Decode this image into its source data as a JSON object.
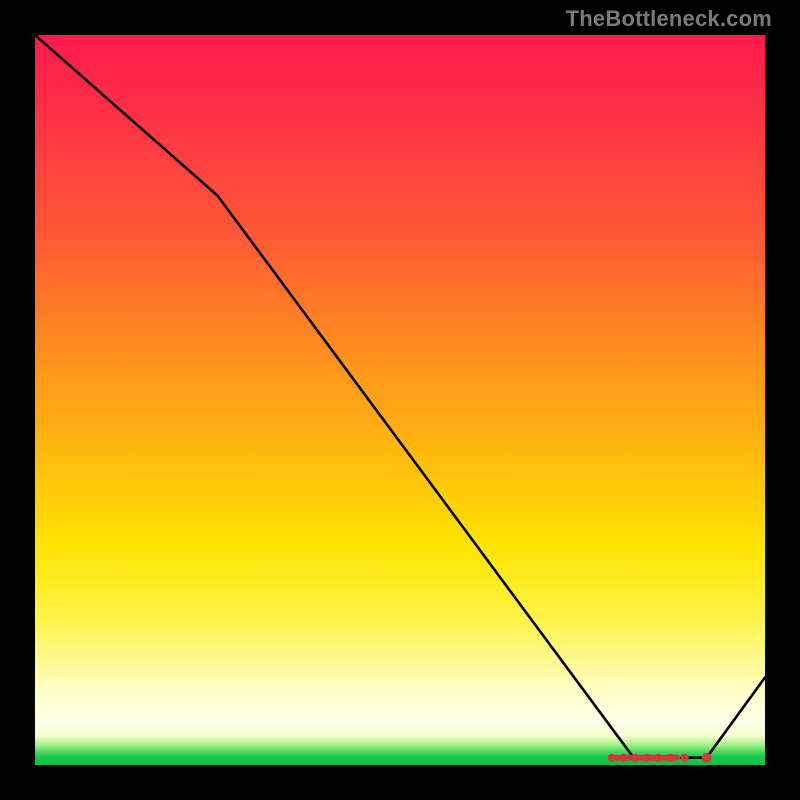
{
  "credit": "TheBottleneck.com",
  "colors": {
    "line": "#000000",
    "dot": "#cc3a3a",
    "bg_top": "#ff1a4d",
    "bg_bottom": "#0fbf45"
  },
  "chart_data": {
    "type": "line",
    "title": "",
    "xlabel": "",
    "ylabel": "",
    "xlim": [
      0,
      100
    ],
    "ylim": [
      0,
      100
    ],
    "grid": false,
    "x": [
      0,
      25,
      82,
      92,
      100
    ],
    "values": [
      100,
      78,
      1,
      1,
      12
    ],
    "marker_cluster": {
      "y": 1,
      "x_dots": [
        79,
        80.6,
        82.2,
        83.8,
        85.4,
        87,
        89,
        92
      ],
      "x_dash": [
        79,
        88
      ]
    }
  }
}
